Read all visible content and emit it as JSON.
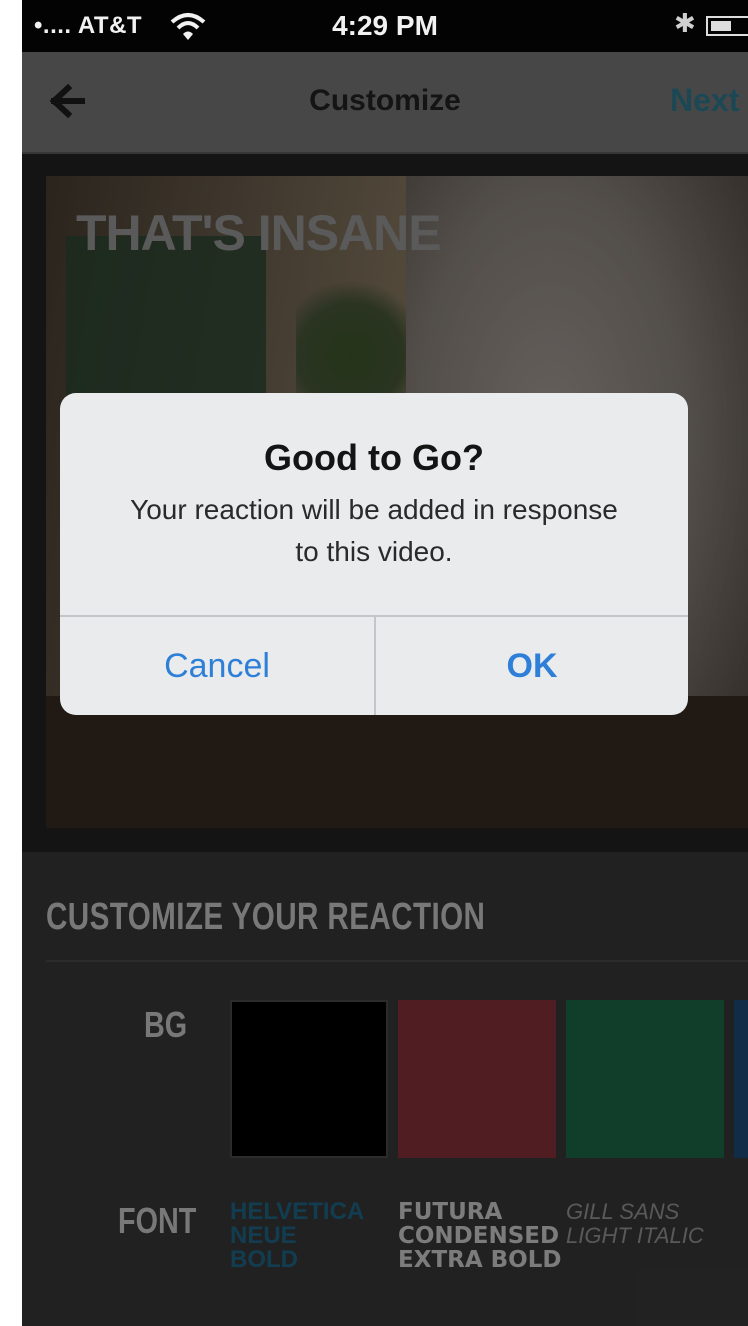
{
  "status_bar": {
    "carrier": "•.... AT&T",
    "time": "4:29 PM"
  },
  "nav": {
    "title": "Customize",
    "next_label": "Next"
  },
  "video": {
    "overlay_text": "THAT'S INSANE"
  },
  "customize": {
    "heading": "CUSTOMIZE YOUR REACTION",
    "bg_label": "BG",
    "bg_colors": [
      "#000000",
      "#8a343b",
      "#1c6c4a",
      "#1d4c7a"
    ],
    "font_label": "FONT",
    "fonts": [
      {
        "name": "HELVETICA\nNEUE\nBOLD",
        "selected": true
      },
      {
        "name": "FUTURA\nCONDENSED\nEXTRA BOLD",
        "selected": false
      },
      {
        "name": "GILL SANS\nLIGHT ITALIC",
        "selected": false
      }
    ]
  },
  "alert": {
    "title": "Good to Go?",
    "message": "Your reaction will be added in response to this video.",
    "cancel_label": "Cancel",
    "ok_label": "OK"
  },
  "colors": {
    "accent_blue": "#2d7fd8",
    "next_teal": "#2f7d92"
  }
}
